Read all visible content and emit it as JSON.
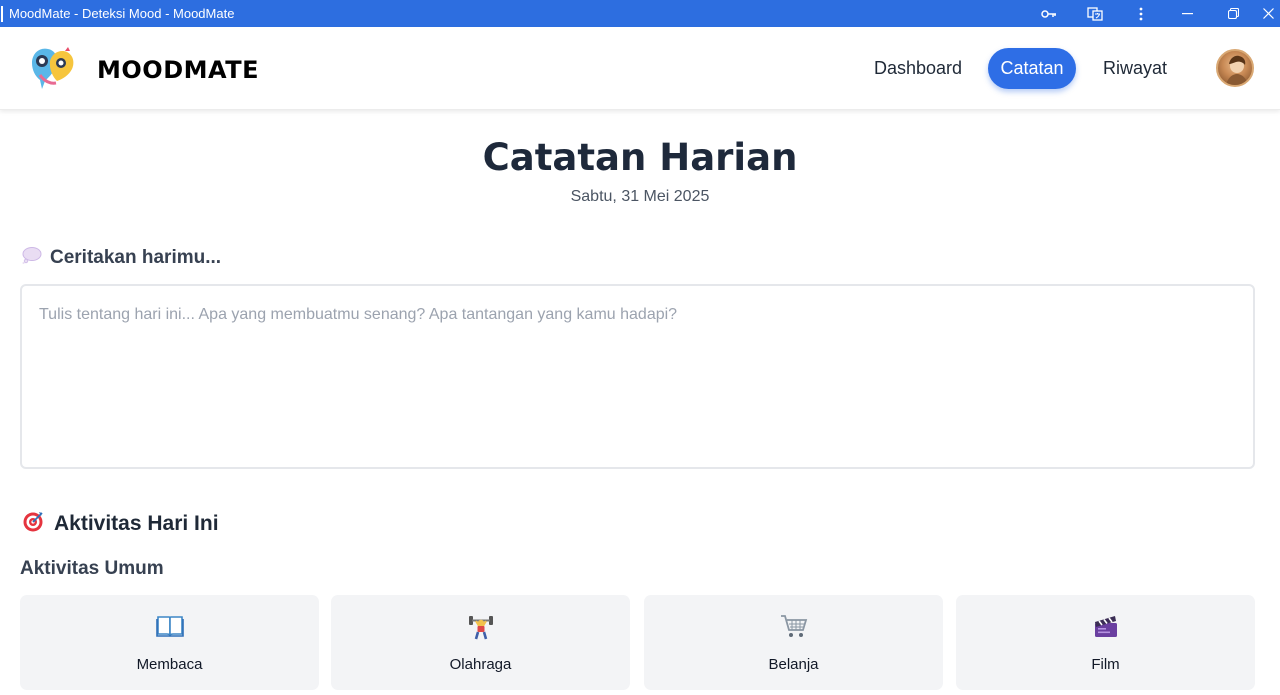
{
  "window": {
    "title": "MoodMate - Deteksi Mood - MoodMate"
  },
  "header": {
    "brand": "MOODMATE",
    "nav": [
      {
        "label": "Dashboard",
        "active": false
      },
      {
        "label": "Catatan",
        "active": true
      },
      {
        "label": "Riwayat",
        "active": false
      }
    ],
    "accent": "#2e6ee6"
  },
  "page": {
    "title": "Catatan Harian",
    "date": "Sabtu, 31 Mei 2025"
  },
  "journal": {
    "label": "Ceritakan harimu...",
    "icon": "thought-bubble-icon",
    "value": "",
    "placeholder": "Tulis tentang hari ini... Apa yang membuatmu senang? Apa tantangan yang kamu hadapi?"
  },
  "activities": {
    "title": "Aktivitas Hari Ini",
    "icon": "target-icon",
    "group_label": "Aktivitas Umum",
    "items": [
      {
        "label": "Membaca",
        "icon": "book-icon"
      },
      {
        "label": "Olahraga",
        "icon": "weightlifter-icon"
      },
      {
        "label": "Belanja",
        "icon": "shopping-cart-icon"
      },
      {
        "label": "Film",
        "icon": "clapper-board-icon"
      }
    ]
  }
}
